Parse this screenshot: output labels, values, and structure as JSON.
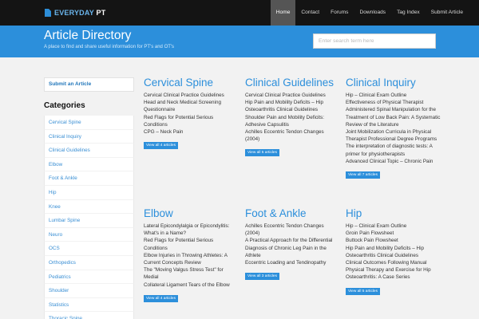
{
  "brand": {
    "prefix": "EVERYDAY",
    "suffix": "PT"
  },
  "nav": [
    "Home",
    "Contact",
    "Forums",
    "Downloads",
    "Tag Index",
    "Submit Article"
  ],
  "header": {
    "title": "Article Directory",
    "subtitle": "A place to find and share useful information for PT's and OT's",
    "search_placeholder": "Enter search term here"
  },
  "sidebar": {
    "submit_label": "Submit an Article",
    "categories_heading": "Categories",
    "categories": [
      "Cervical Spine",
      "Clinical Inquiry",
      "Clinical Guidelines",
      "Elbow",
      "Foot & Ankle",
      "Hip",
      "Knee",
      "Lumbar Spine",
      "Neuro",
      "OCS",
      "Orthopedics",
      "Pediatrics",
      "Shoulder",
      "Statistics",
      "Thoracic Spine"
    ]
  },
  "sections": [
    {
      "title": "Cervical Spine",
      "lines": [
        "Cervical Clinical Practice Guidelines",
        "Head and Neck Medical Screening",
        "Questionnaire",
        "Red Flags for Potential Serious Conditions",
        "CPG – Neck Pain"
      ],
      "view_all": "View all 4 articles"
    },
    {
      "title": "Clinical Guidelines",
      "lines": [
        "Cervical Clinical Practice Guidelines",
        "Hip Pain and Mobility Deficits – Hip",
        "Osteoarthritis Clinical Guidelines",
        "Shoulder Pain and Mobility Deficits:",
        "Adhesive Capsulitis",
        "Achilles Eccentric Tendon Changes (2004)"
      ],
      "view_all": "View all 5 articles"
    },
    {
      "title": "Clinical Inquiry",
      "lines": [
        "Hip – Clinical Exam Outline",
        "Effectiveness of Physical Therapist",
        "Administered Spinal Manipulation for the",
        "Treatment of Low Back Pain: A Systematic",
        "Review of the Literature",
        "Joint Mobilization Curricula in Physical",
        "Therapist Professional Degree Programs",
        "The interpretation of diagnostic tests: A",
        "primer for physiotherapists",
        "Advanced Clinical Topic – Chronic Pain"
      ],
      "view_all": "View all 7 articles"
    },
    {
      "title": "Elbow",
      "lines": [
        "Lateral Epicondylalgia or Epicondylitis:",
        "What's in a Name?",
        "Red Flags for Potential Serious Conditions",
        "Elbow Injuries in Throwing Athletes: A",
        "Current Concepts Review",
        "The \"Moving Valgus Stress Test\" for Medial",
        "Collateral Ligament Tears of the Elbow"
      ],
      "view_all": "View all 4 articles"
    },
    {
      "title": "Foot & Ankle",
      "lines": [
        "Achilles Eccentric Tendon Changes (2004)",
        "A Practical Approach for the Differential",
        "Diagnosis of Chronic Leg Pain in the",
        "Athlete",
        "Eccentric Loading and Tendinopathy"
      ],
      "view_all": "View all 3 articles"
    },
    {
      "title": "Hip",
      "lines": [
        "Hip – Clinical Exam Outline",
        "Groin Pain Flowsheet",
        "Buttock Pain Flowsheet",
        "Hip Pain and Mobility Deficits – Hip",
        "Osteoarthritis Clinical Guidelines",
        "Clinical Outcomes Following Manual",
        "Physical Therapy and Exercise for Hip",
        "Osteoarthritis: A Case Series"
      ],
      "view_all": "View all 5 articles"
    }
  ]
}
